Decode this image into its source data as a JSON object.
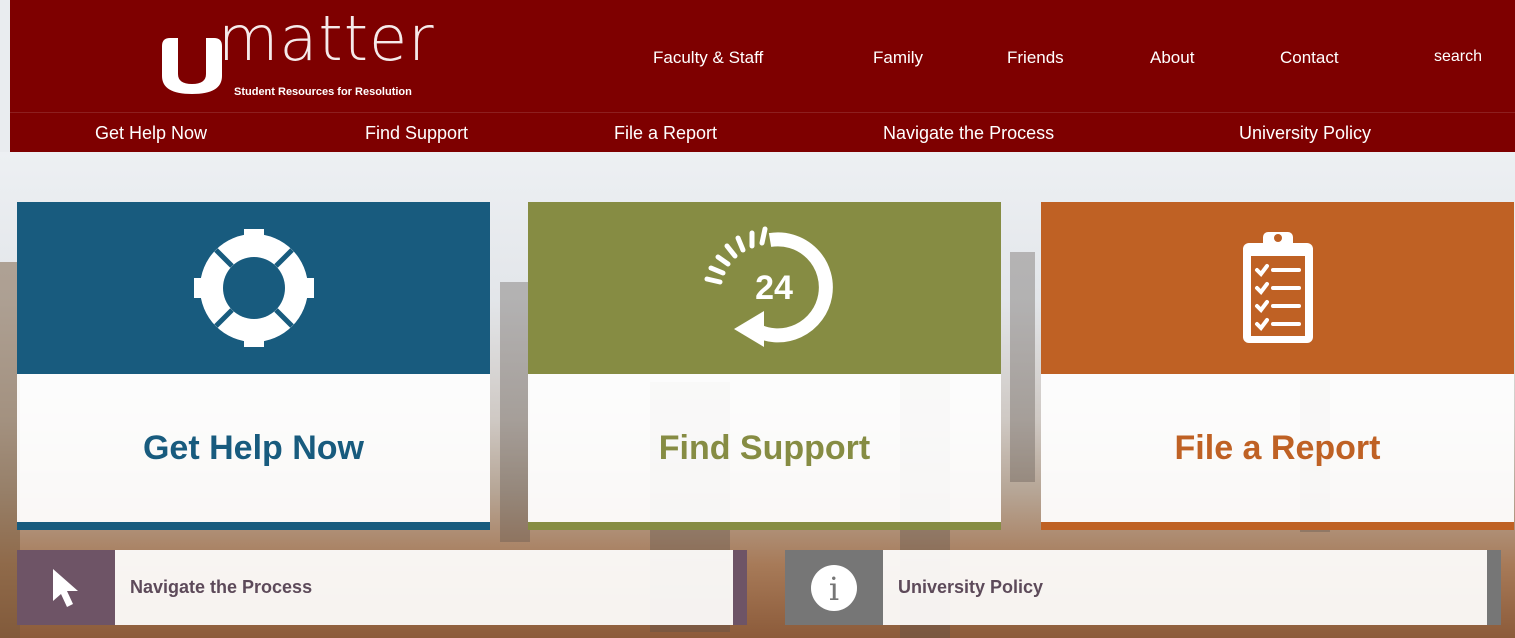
{
  "brand": {
    "logo_word": "matter",
    "tagline": "Student Resources for Resolution"
  },
  "top_nav": [
    "Faculty & Staff",
    "Family",
    "Friends",
    "About",
    "Contact",
    "search"
  ],
  "sub_nav": [
    "Get Help Now",
    "Find Support",
    "File a Report",
    "Navigate the Process",
    "University Policy"
  ],
  "tiles": [
    {
      "label": "Get Help Now",
      "icon": "lifebuoy-icon",
      "color": "#185b7e"
    },
    {
      "label": "Find Support",
      "icon": "24-hour-icon",
      "icon_text": "24",
      "color": "#868c43"
    },
    {
      "label": "File a Report",
      "icon": "clipboard-icon",
      "color": "#bf6124"
    }
  ],
  "links": [
    {
      "label": "Navigate the Process",
      "icon": "cursor-arrow-icon",
      "color": "#6e5466"
    },
    {
      "label": "University Policy",
      "icon": "info-icon",
      "icon_text": "i",
      "color": "#767676"
    }
  ],
  "colors": {
    "header_bg": "#7e0000"
  }
}
